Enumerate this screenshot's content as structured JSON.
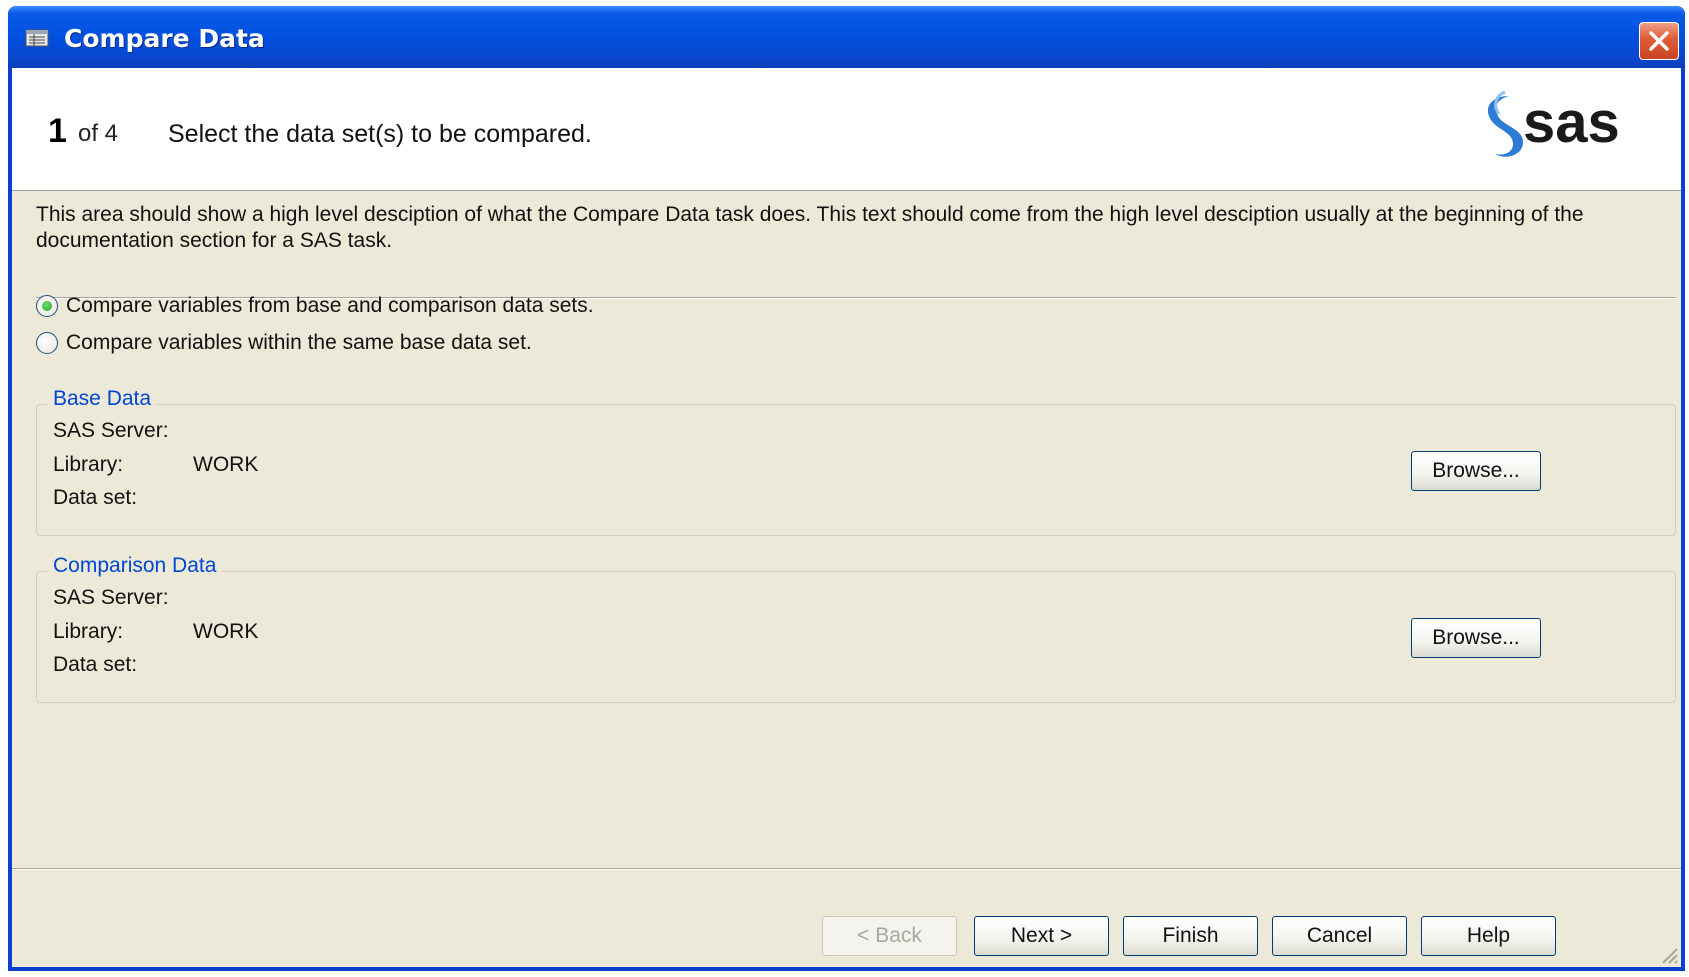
{
  "window": {
    "title": "Compare Data"
  },
  "header": {
    "step_number": "1",
    "step_of": "of 4",
    "step_title": "Select the data set(s) to be compared.",
    "logo_text": "sas"
  },
  "description": "This area should show a high level desciption of what the Compare Data task does.  This text should come from the high level desciption usually at the beginning of the documentation section for a SAS task.",
  "options": [
    {
      "label": "Compare variables from base and comparison data sets.",
      "checked": true
    },
    {
      "label": "Compare variables within the same base data set.",
      "checked": false
    }
  ],
  "base_data": {
    "legend": "Base Data",
    "server_label": "SAS Server:",
    "server_value": "",
    "library_label": "Library:",
    "library_value": "WORK",
    "dataset_label": "Data set:",
    "dataset_value": "",
    "browse_label": "Browse..."
  },
  "comparison_data": {
    "legend": "Comparison Data",
    "server_label": "SAS Server:",
    "server_value": "",
    "library_label": "Library:",
    "library_value": "WORK",
    "dataset_label": "Data set:",
    "dataset_value": "",
    "browse_label": "Browse..."
  },
  "buttons": {
    "back": "< Back",
    "next": "Next >",
    "finish": "Finish",
    "cancel": "Cancel",
    "help": "Help"
  },
  "colors": {
    "titlebar": "#0150df",
    "dialog_bg": "#ece9d8",
    "group_legend": "#0046d5",
    "close_button": "#e0603c"
  },
  "icons": [
    "app-icon",
    "close-icon",
    "sas-logo",
    "resize-grip-icon"
  ]
}
